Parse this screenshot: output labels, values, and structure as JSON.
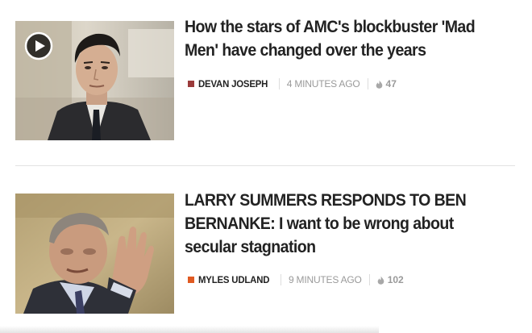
{
  "articles": [
    {
      "headline": "How the stars of AMC's blockbuster 'Mad Men' have changed over the years",
      "author": "DEVAN JOSEPH",
      "time": "4 MINUTES AGO",
      "count": "47",
      "tag_color": "#9b3b3b",
      "icons": [
        "play-icon",
        "flame-icon"
      ]
    },
    {
      "headline": "LARRY SUMMERS RESPONDS TO BEN BERNANKE: I want to be wrong about secular stagnation",
      "author": "MYLES UDLAND",
      "time": "9 MINUTES AGO",
      "count": "102",
      "tag_color": "#e05a22",
      "icons": [
        "flame-icon"
      ]
    }
  ]
}
